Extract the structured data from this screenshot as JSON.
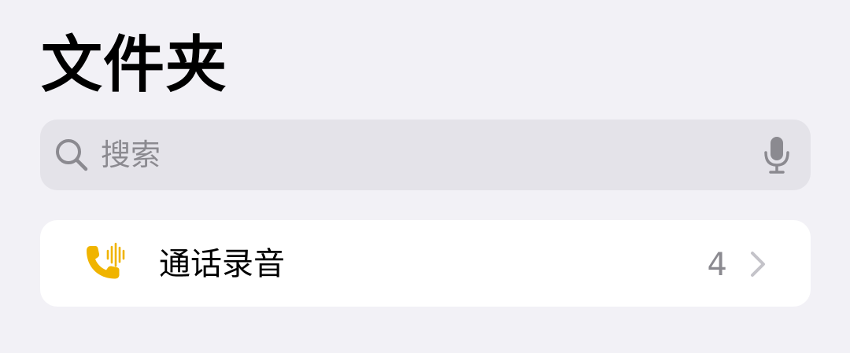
{
  "header": {
    "title": "文件夹"
  },
  "search": {
    "placeholder": "搜索",
    "value": "",
    "icon": "search-icon",
    "mic_icon": "microphone-icon"
  },
  "folders": [
    {
      "name": "通话录音",
      "count": "4",
      "icon": "phone-recording-icon",
      "icon_color": "#f0b400"
    }
  ],
  "colors": {
    "background": "#f2f1f6",
    "search_bar": "#e4e3e9",
    "secondary_text": "#8b8a90",
    "accent": "#f0b400"
  }
}
